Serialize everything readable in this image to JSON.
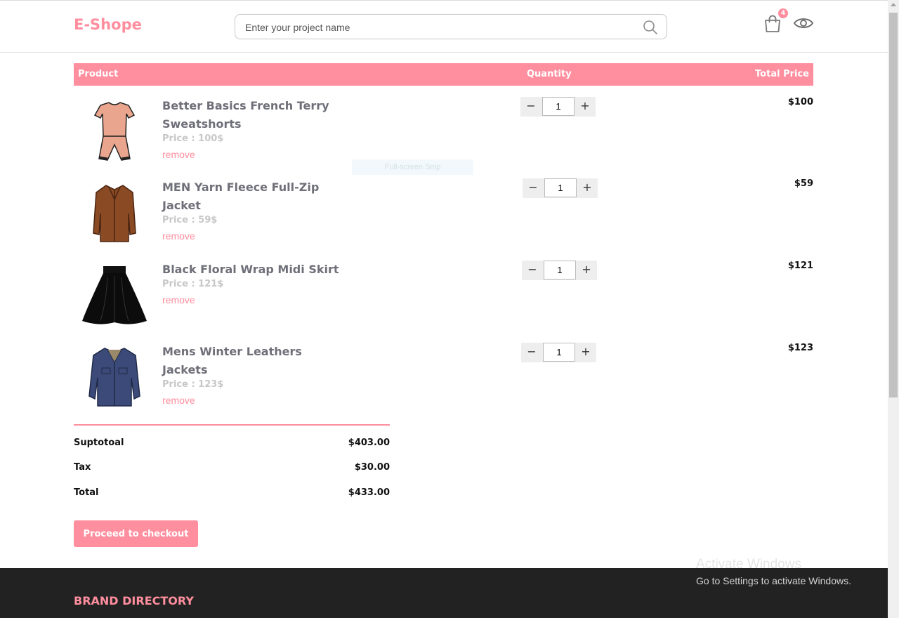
{
  "header": {
    "logo": "E-Shope",
    "search_placeholder": "Enter your project name",
    "cart_count": "4"
  },
  "table": {
    "col_product": "Product",
    "col_quantity": "Quantity",
    "col_total": "Total Price"
  },
  "items": [
    {
      "name": "Better Basics French Terry Sweatshorts",
      "price": "Price : 100$",
      "remove": "remove",
      "quantity": "1",
      "total": "$100",
      "image": "pink-shorts-set"
    },
    {
      "name": "MEN Yarn Fleece Full-Zip Jacket",
      "price": "Price : 59$",
      "remove": "remove",
      "quantity": "1",
      "total": "$59",
      "image": "brown-coat"
    },
    {
      "name": "Black Floral Wrap Midi Skirt",
      "price": "Price : 121$",
      "remove": "remove",
      "quantity": "1",
      "total": "$121",
      "image": "black-skirt"
    },
    {
      "name": "Mens Winter Leathers Jackets",
      "price": "Price : 123$",
      "remove": "remove",
      "quantity": "1",
      "total": "$123",
      "image": "denim-jacket"
    }
  ],
  "qty_controls": {
    "minus": "−",
    "plus": "+"
  },
  "overlay": {
    "snip": "Full-screen Snip"
  },
  "summary": {
    "subtotal_label": "Suptotoal",
    "subtotal": "$403.00",
    "tax_label": "Tax",
    "tax": "$30.00",
    "total_label": "Total",
    "total": "$433.00"
  },
  "checkout_label": "Proceed to checkout",
  "footer": {
    "brand_directory": "BRAND DIRECTORY"
  },
  "watermark": {
    "line1": "Activate Windows",
    "line2": "Go to Settings to activate Windows."
  },
  "colors": {
    "accent": "#ff8e9e",
    "footer_bg": "#222222"
  }
}
